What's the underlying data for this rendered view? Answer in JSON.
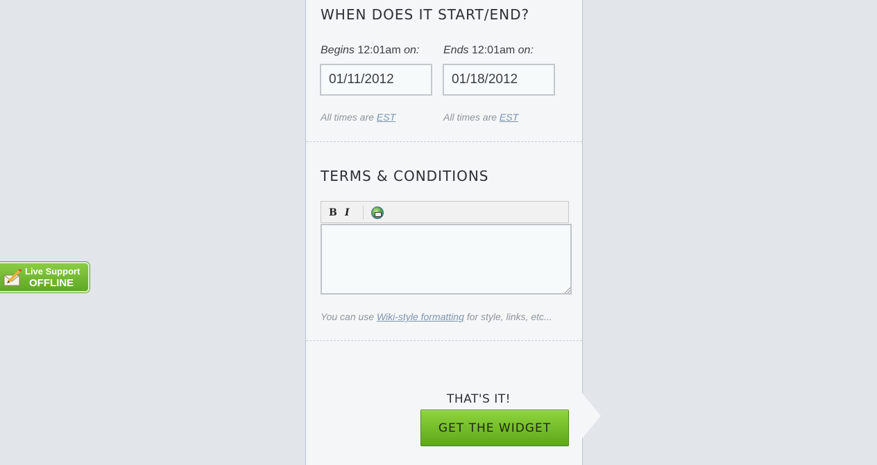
{
  "schedule": {
    "title": "WHEN DOES IT START/END?",
    "begins_prefix": "Begins",
    "begins_time": "12:01am",
    "begins_suffix": "on:",
    "ends_prefix": "Ends",
    "ends_time": "12:01am",
    "ends_suffix": "on:",
    "start_date": "01/11/2012",
    "end_date": "01/18/2012",
    "tz_text": "All times are",
    "tz_link": "EST"
  },
  "terms": {
    "title": "TERMS & CONDITIONS",
    "toolbar": {
      "bold": "B",
      "italic": "I",
      "link_icon": "globe-link-icon"
    },
    "value": "",
    "hint_prefix": "You can use",
    "hint_link": "Wiki-style formatting",
    "hint_suffix": "for style, links, etc..."
  },
  "cta": {
    "heading": "THAT'S IT!",
    "button_label": "GET THE WIDGET"
  },
  "live_support": {
    "line1": "Live Support",
    "line2": "OFFLINE",
    "icon": "envelope-pencil-icon",
    "color": "#6fb52e"
  },
  "colors": {
    "background": "#e2e5e9",
    "panel": "#f4f6f8",
    "accent_green": "#7cc234",
    "link": "#7d94ad"
  }
}
